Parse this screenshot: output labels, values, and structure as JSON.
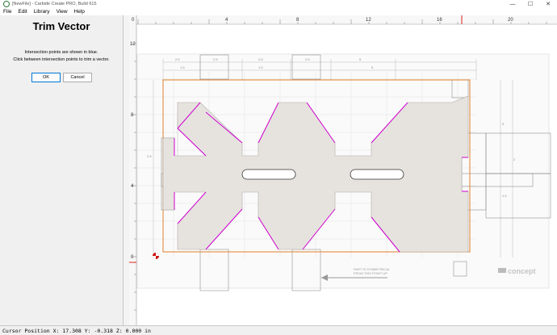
{
  "window": {
    "title": "[NewFile] - Carbide Create PRO, Build 615",
    "minimize_glyph": "—",
    "maximize_glyph": "☐",
    "close_glyph": "✕"
  },
  "menu": [
    "File",
    "Edit",
    "Library",
    "View",
    "Help"
  ],
  "panel": {
    "title": "Trim Vector",
    "help_line1": "Intersection points are shown in blue.",
    "help_line2": "Click between intersection points to trim a vector.",
    "ok_label": "OK",
    "cancel_label": "Cancel"
  },
  "ruler": {
    "top_labels": [
      "0",
      "4",
      "8",
      "12",
      "16",
      "20"
    ],
    "left_labels": [
      "12",
      "8",
      "4",
      "0"
    ]
  },
  "drawing": {
    "note_line1": "PART IS SYMMETRICAL",
    "note_line2": "FROM THIS POINT UP",
    "logo": "concept",
    "dims": [
      "2.5",
      "2.5",
      "2.5",
      "2.5",
      "5",
      "1.5",
      "1.5",
      "5",
      "2.5",
      "3",
      "1.5",
      "2",
      "3"
    ]
  },
  "colors": {
    "accent": "#0078d7",
    "part_fill": "#e6e3df",
    "trim_path": "#d000d0",
    "stock_outline": "#e0802a",
    "origin_marker": "#d01010",
    "cursor_line": "#e02020"
  },
  "status": {
    "cursor": "Cursor Position X: 17.308 Y: -0.318 Z: 0.000 in"
  }
}
